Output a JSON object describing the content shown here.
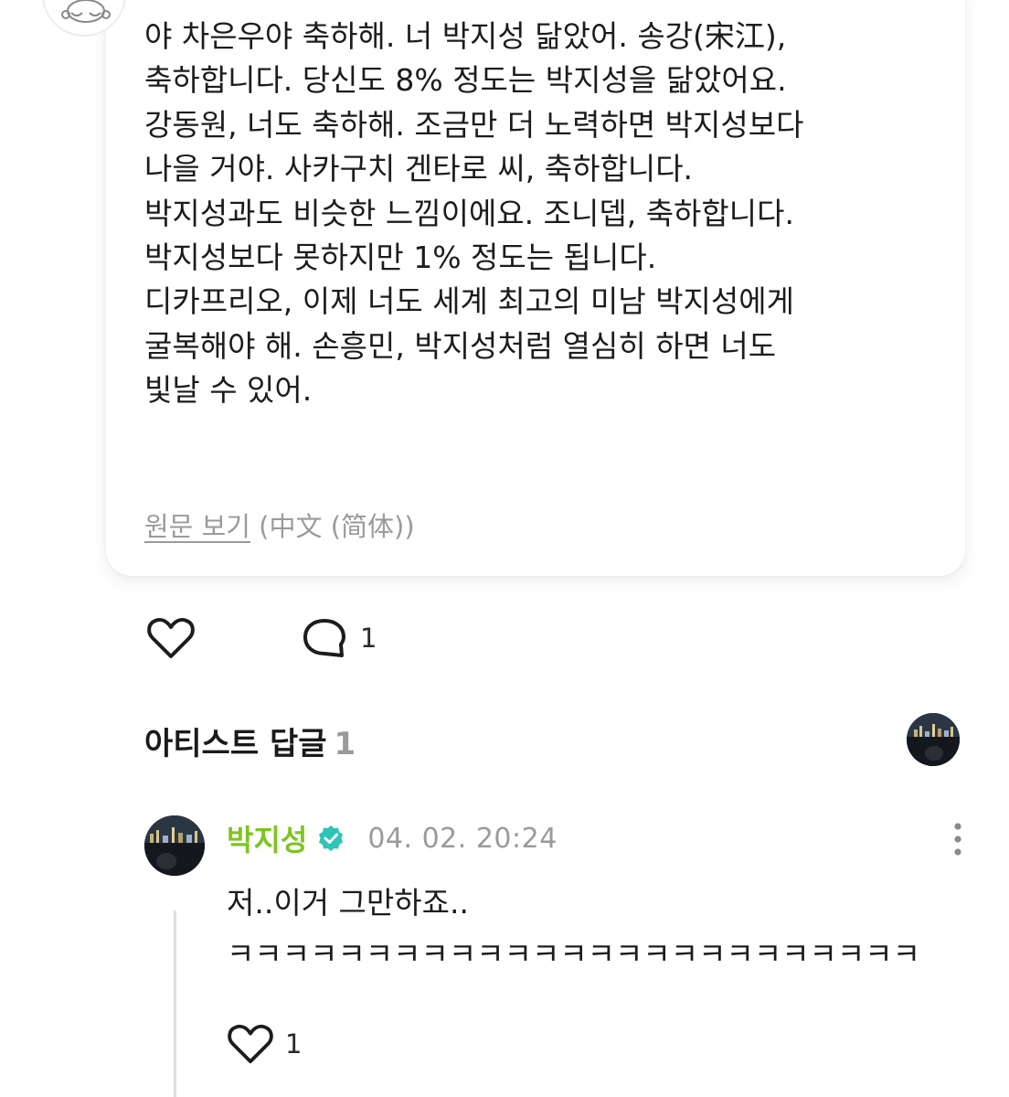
{
  "post": {
    "author_avatar_icon": "cartoon-character-avatar-icon",
    "translated_lines": [
      "야 차은우야 축하해. 너 박지성 닮았어. 송강(宋江),",
      "축하합니다. 당신도 8% 정도는 박지성을 닮았어요.",
      "강동원, 너도 축하해. 조금만 더 노력하면 박지성보다",
      "나을 거야. 사카구치 겐타로 씨, 축하합니다.",
      "박지성과도 비슷한 느낌이에요. 조니뎁, 축하합니다.",
      "박지성보다 못하지만 1% 정도는 됩니다.",
      "디카프리오, 이제 너도 세계 최고의 미남 박지성에게",
      "굴복해야 해. 손흥민, 박지성처럼 열심히 하면 너도",
      "빛날 수 있어."
    ],
    "view_original_label": "원문 보기",
    "original_language": "(中文 (简体))",
    "like_icon": "heart-outline-icon",
    "comment_icon": "speech-bubble-icon",
    "comment_count": "1"
  },
  "artist_replies": {
    "title": "아티스트 답글",
    "count": "1",
    "thumbnail_icon": "night-cityscape-avatar"
  },
  "reply": {
    "author": "박지성",
    "verified_icon": "verified-badge-icon",
    "timestamp": "04. 02. 20:24",
    "lines": [
      "저..이거 그만하죠..",
      "ㅋㅋㅋㅋㅋㅋㅋㅋㅋㅋㅋㅋㅋㅋㅋㅋㅋㅋㅋㅋㅋㅋㅋㅋㅋ"
    ],
    "like_count": "1",
    "more_icon": "more-vertical-icon"
  },
  "colors": {
    "accent_green": "#7cc51f",
    "verified_teal": "#2ec4b6",
    "muted_gray": "#9a9a9a",
    "text": "#1c1c1c"
  }
}
